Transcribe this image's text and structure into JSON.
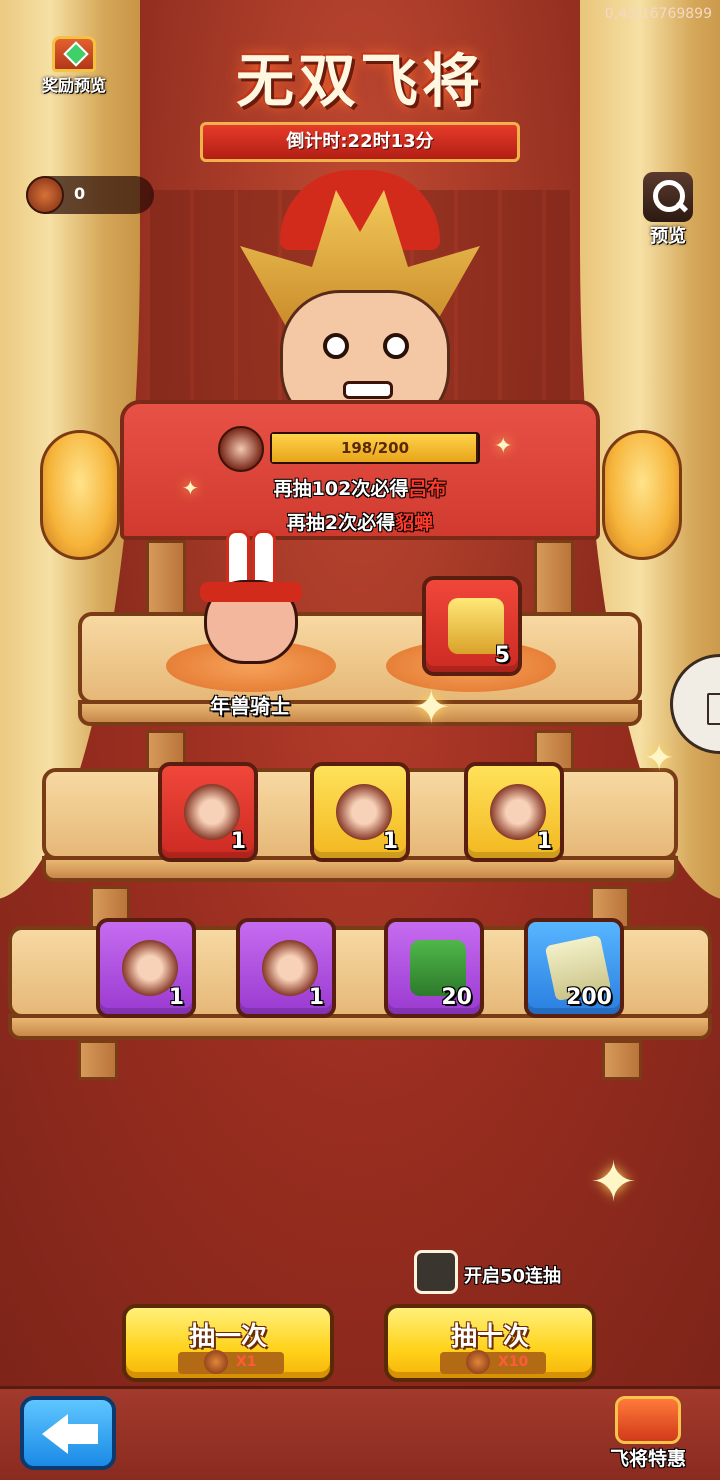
{
  "debug_text": "0,43|16769899",
  "header": {
    "reward_preview_label": "奖励预览",
    "title": "无双飞将",
    "countdown": "倒计时:22时13分",
    "preview_label": "预览"
  },
  "currency": {
    "count": "0",
    "icon": "dragon-token-icon"
  },
  "progress": {
    "text": "198/200",
    "current": 198,
    "max": 200
  },
  "notices": {
    "line1_prefix": "再抽102次必得",
    "line1_hero": "吕布",
    "line2_prefix": "再抽2次必得",
    "line2_hero": "貂蝉"
  },
  "featured": {
    "knight_label": "年兽骑士",
    "gold_seal_qty": "5"
  },
  "row2": [
    {
      "rarity": "red",
      "qty": "1",
      "icon": "hero-portrait-icon"
    },
    {
      "rarity": "gold",
      "qty": "1",
      "icon": "hero-portrait-icon"
    },
    {
      "rarity": "gold",
      "qty": "1",
      "icon": "hero-portrait-icon"
    }
  ],
  "row3": [
    {
      "rarity": "purple",
      "qty": "1",
      "icon": "hero-portrait-icon"
    },
    {
      "rarity": "purple",
      "qty": "1",
      "icon": "hero-portrait-icon"
    },
    {
      "rarity": "purple",
      "qty": "20",
      "icon": "jade-seal-icon"
    },
    {
      "rarity": "blue",
      "qty": "200",
      "icon": "scroll-icon"
    }
  ],
  "controls": {
    "fifty_draw_label": "开启50连抽",
    "draw_one_label": "抽一次",
    "draw_one_cost": "X1",
    "draw_ten_label": "抽十次",
    "draw_ten_cost": "X10"
  },
  "footer": {
    "deal_label": "飞将特惠"
  },
  "colors": {
    "highlight_red": "#ff3a2a",
    "button_yellow": "#ffd21a",
    "back_blue": "#1a8ae6"
  }
}
